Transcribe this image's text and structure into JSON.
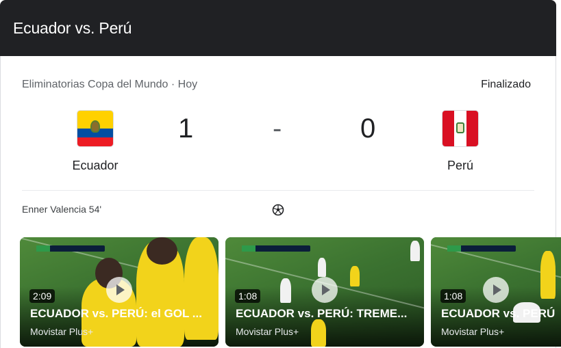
{
  "header": {
    "title": "Ecuador vs. Perú"
  },
  "match": {
    "competition": "Eliminatorias Copa del Mundo · Hoy",
    "status": "Finalizado",
    "home": {
      "name": "Ecuador",
      "score": "1",
      "flag_icon": "ecuador-flag-icon"
    },
    "separator": "-",
    "away": {
      "name": "Perú",
      "score": "0",
      "flag_icon": "peru-flag-icon"
    },
    "scorer": "Enner Valencia 54'",
    "goal_icon": "soccer-ball-icon"
  },
  "videos": [
    {
      "duration": "2:09",
      "title": "ECUADOR vs. PERÚ: el GOL ...",
      "source": "Movistar Plus+"
    },
    {
      "duration": "1:08",
      "title": "ECUADOR vs. PERÚ: TREME...",
      "source": "Movistar Plus+"
    },
    {
      "duration": "1:08",
      "title": "ECUADOR vs. PERÚ",
      "source": "Movistar Plus+"
    }
  ],
  "colors": {
    "header_bg": "#202124",
    "ecuador_yellow": "#ffd100",
    "ecuador_blue": "#034ea2",
    "ecuador_red": "#ed1c24",
    "peru_red": "#d91023"
  }
}
